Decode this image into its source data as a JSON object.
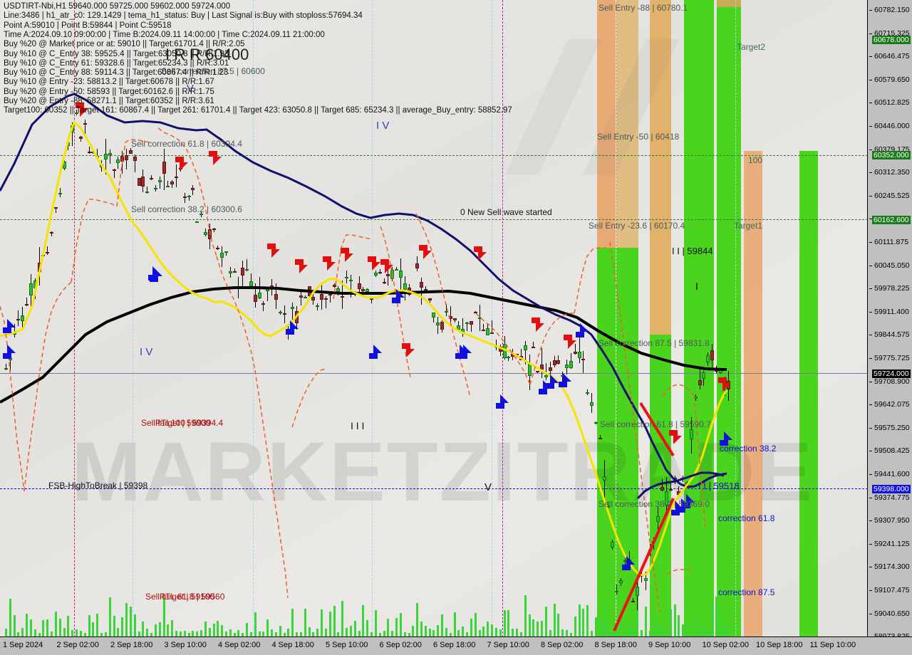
{
  "window": {
    "symbol_line": "USDTIRT-Nbi,H1   59640.000 59725.000 59602.000 59724.000",
    "info_lines": [
      "Line:3486 |  h1_atr_c0: 129.1429 |  tema_h1_status: Buy |  Last Signal is:Buy with stoploss:57694.34",
      "Point A:59010 |  Point B:59844 |  Point C:59518",
      "Time A:2024.09.10 09:00:00 |  Time B:2024.09.11 14:00:00 |  Time C:2024.09.11 21:00:00",
      "Buy %20 @ Market price or at: 59010 || Target:61701.4 || R/R:2.05",
      "Buy %10 @ C_Entry 38: 59525.4 ||  Target:63050.8 ||  R/R:1.93",
      "Buy %10 @ C_Entry 61: 59328.6 ||  Target:65234.3 ||  R/R:3.01",
      "Buy %10 @ C_Entry 88: 59114.3 ||  Target:60867.4 ||  R/R:1.23",
      "Buy %10 @ Entry -23: 58813.2 ||  Target:60678 ||  R/R:1.67",
      "Buy %20 @ Entry -50: 58593 ||  Target:60162.6 ||  R/R:1.75",
      "Buy %20 @ Entry -88: 58271.1 ||  Target:60352 ||  R/R:3.61",
      "Target100: 60352 || Target 161: 60867.4 ||  Target 261: 61701.4 ||  Target 423: 63050.8 ||  Target 685: 65234.3 ||  average_Buy_entry: 58852.97"
    ]
  },
  "watermark": {
    "text": "MARKETZITRADE"
  },
  "chart_data": {
    "type": "candlestick",
    "title": "USDTIRT-Nbi,H1",
    "timeframe": "H1",
    "ohlc": {
      "open": 59640.0,
      "high": 59725.0,
      "low": 59602.0,
      "close": 59724.0
    },
    "ylim": [
      58940.0,
      60810.0
    ],
    "y_ticks": [
      "60782.150",
      "60715.325",
      "60646.475",
      "60579.650",
      "60512.825",
      "60446.000",
      "60379.175",
      "60312.350",
      "60245.525",
      "60178.700",
      "60111.875",
      "60045.050",
      "59978.225",
      "59911.400",
      "59844.575",
      "59775.725",
      "59708.900",
      "59642.075",
      "59575.250",
      "59508.425",
      "59441.600",
      "59374.775",
      "59307.950",
      "59241.125",
      "59174.300",
      "59107.475",
      "59040.650",
      "58973.825"
    ],
    "x_ticks": [
      "1 Sep 2024",
      "2 Sep 02:00",
      "2 Sep 18:00",
      "3 Sep 10:00",
      "4 Sep 02:00",
      "4 Sep 18:00",
      "5 Sep 10:00",
      "6 Sep 02:00",
      "6 Sep 18:00",
      "7 Sep 10:00",
      "8 Sep 02:00",
      "8 Sep 18:00",
      "9 Sep 10:00",
      "10 Sep 02:00",
      "10 Sep 18:00",
      "11 Sep 10:00"
    ],
    "price_tags": [
      {
        "value": "60678.000",
        "bg": "#1a7a1a",
        "fg": "#ffffff"
      },
      {
        "value": "60352.000",
        "bg": "#1a7a1a",
        "fg": "#ffffff"
      },
      {
        "value": "60162.600",
        "bg": "#1a7a1a",
        "fg": "#ffffff"
      },
      {
        "value": "59724.000",
        "bg": "#000000",
        "fg": "#ffffff"
      },
      {
        "value": "59398.000",
        "bg": "#1111dd",
        "fg": "#ffffff"
      }
    ],
    "series": [
      {
        "name": "MA slow (black)",
        "color": "#000000"
      },
      {
        "name": "MA mid (navy)",
        "color": "#10106e"
      },
      {
        "name": "MA fast (yellow)",
        "color": "#f5e400"
      },
      {
        "name": "Channel (orange dashed)",
        "color": "#e8622a"
      }
    ],
    "levels": [
      {
        "label": "Target2",
        "price": 60678.0,
        "color": "#1a7a1a"
      },
      {
        "label": "100",
        "price": 60352.0,
        "color": "#1a7a1a"
      },
      {
        "label": "Target1",
        "price": 60162.6,
        "color": "#1a7a1a"
      }
    ]
  },
  "annotations": [
    {
      "name": "sell-entry-88",
      "text": "Sell Entry -88 | 60780.1",
      "color": "#4a5a5a"
    },
    {
      "name": "sell-entry-50",
      "text": "Sell Entry -50 | 60418",
      "color": "#4a5a5a"
    },
    {
      "name": "sell-entry-236",
      "text": "Sell Entry -23.6 | 60170.4",
      "color": "#4a5a5a"
    },
    {
      "name": "target2",
      "text": "Target2",
      "color": "#3d6b5a"
    },
    {
      "name": "target1",
      "text": "Target1",
      "color": "#3d6b5a"
    },
    {
      "name": "level-100",
      "text": "100",
      "color": "#3d6b5a"
    },
    {
      "name": "new-sell-wave",
      "text": "0 New Sell wave started",
      "color": "#111111"
    },
    {
      "name": "point-b-label",
      "text": "I I | 59844",
      "color": "#111111"
    },
    {
      "name": "point-c-label",
      "text": "I I | 59518",
      "color": "#1111cc"
    },
    {
      "name": "sell-correction-618-top",
      "text": "Sell correction 61.8 | 60394.4",
      "color": "#4a5a5a"
    },
    {
      "name": "sell-correction-382-top",
      "text": "Sell correction 38.2 | 60300.6",
      "color": "#4a5a5a"
    },
    {
      "name": "sell-correction-875-top",
      "text": "Sell correction 87.5 | 60600",
      "color": "#4a5a5a"
    },
    {
      "name": "sell-correction-875",
      "text": "Sell correction 87.5 | 59831.8",
      "color": "#4a5a5a"
    },
    {
      "name": "sell-correction-618",
      "text": "Sell correction 61.8 | 59590.7",
      "color": "#4a5a5a"
    },
    {
      "name": "sell-correction-382",
      "text": "Sell correction 38.2 | 59369.0",
      "color": "#4a5a5a"
    },
    {
      "name": "correction-382",
      "text": "correction 38.2",
      "color": "#1111cc"
    },
    {
      "name": "correction-618",
      "text": "correction 61.8",
      "color": "#1111cc"
    },
    {
      "name": "correction-875",
      "text": "correction 87.5",
      "color": "#1111cc"
    },
    {
      "name": "fsb-hightobreak",
      "text": "FSB-HighToBreak | 59398",
      "color": "#111111"
    },
    {
      "name": "iv-label-top",
      "text": "I V",
      "color": "#3344aa"
    },
    {
      "name": "iv-label-mid",
      "text": "I V",
      "color": "#3344aa"
    },
    {
      "name": "v-label-top",
      "text": "V",
      "color": "#3344aa"
    },
    {
      "name": "v-label-mid",
      "text": "V",
      "color": "#111111"
    },
    {
      "name": "iii-label",
      "text": "I I I",
      "color": "#111111"
    },
    {
      "name": "i-label",
      "text": "I",
      "color": "#111111"
    },
    {
      "name": "rrr-watermark",
      "text": "I R R 60400",
      "color": "#222222"
    },
    {
      "name": "sell-target-overlap",
      "text": "Sell target | 59000",
      "color": "#aa1111"
    },
    {
      "name": "ptl100-overlap",
      "text": "PTL100 | 59394.4",
      "color": "#aa1111"
    },
    {
      "name": "sell-target-low",
      "text": "Sell target | 59100",
      "color": "#aa1111"
    },
    {
      "name": "ptl-low",
      "text": "PTL 61.8 | 59560",
      "color": "#aa1111"
    }
  ],
  "colors": {
    "plot_bg": "#e6e4e0",
    "panel_bg": "#c0c0c0",
    "band_green": "#4ad41e",
    "band_orange": "#e8a062",
    "band_tan": "#dfb46a",
    "up_candle": "#2fbd2f",
    "down_candle": "#9e2b2b",
    "volume": "#3bd43b",
    "ma_black": "#000000",
    "ma_navy": "#10106e",
    "ma_yellow": "#f5e400",
    "channel_orange": "#e8622a",
    "level_green": "#2e7d32",
    "signal_blue": "#1111dd",
    "arrow_red": "#e11010",
    "magenta_line": "#b0248a",
    "cyan_line": "#9fd8e8"
  }
}
